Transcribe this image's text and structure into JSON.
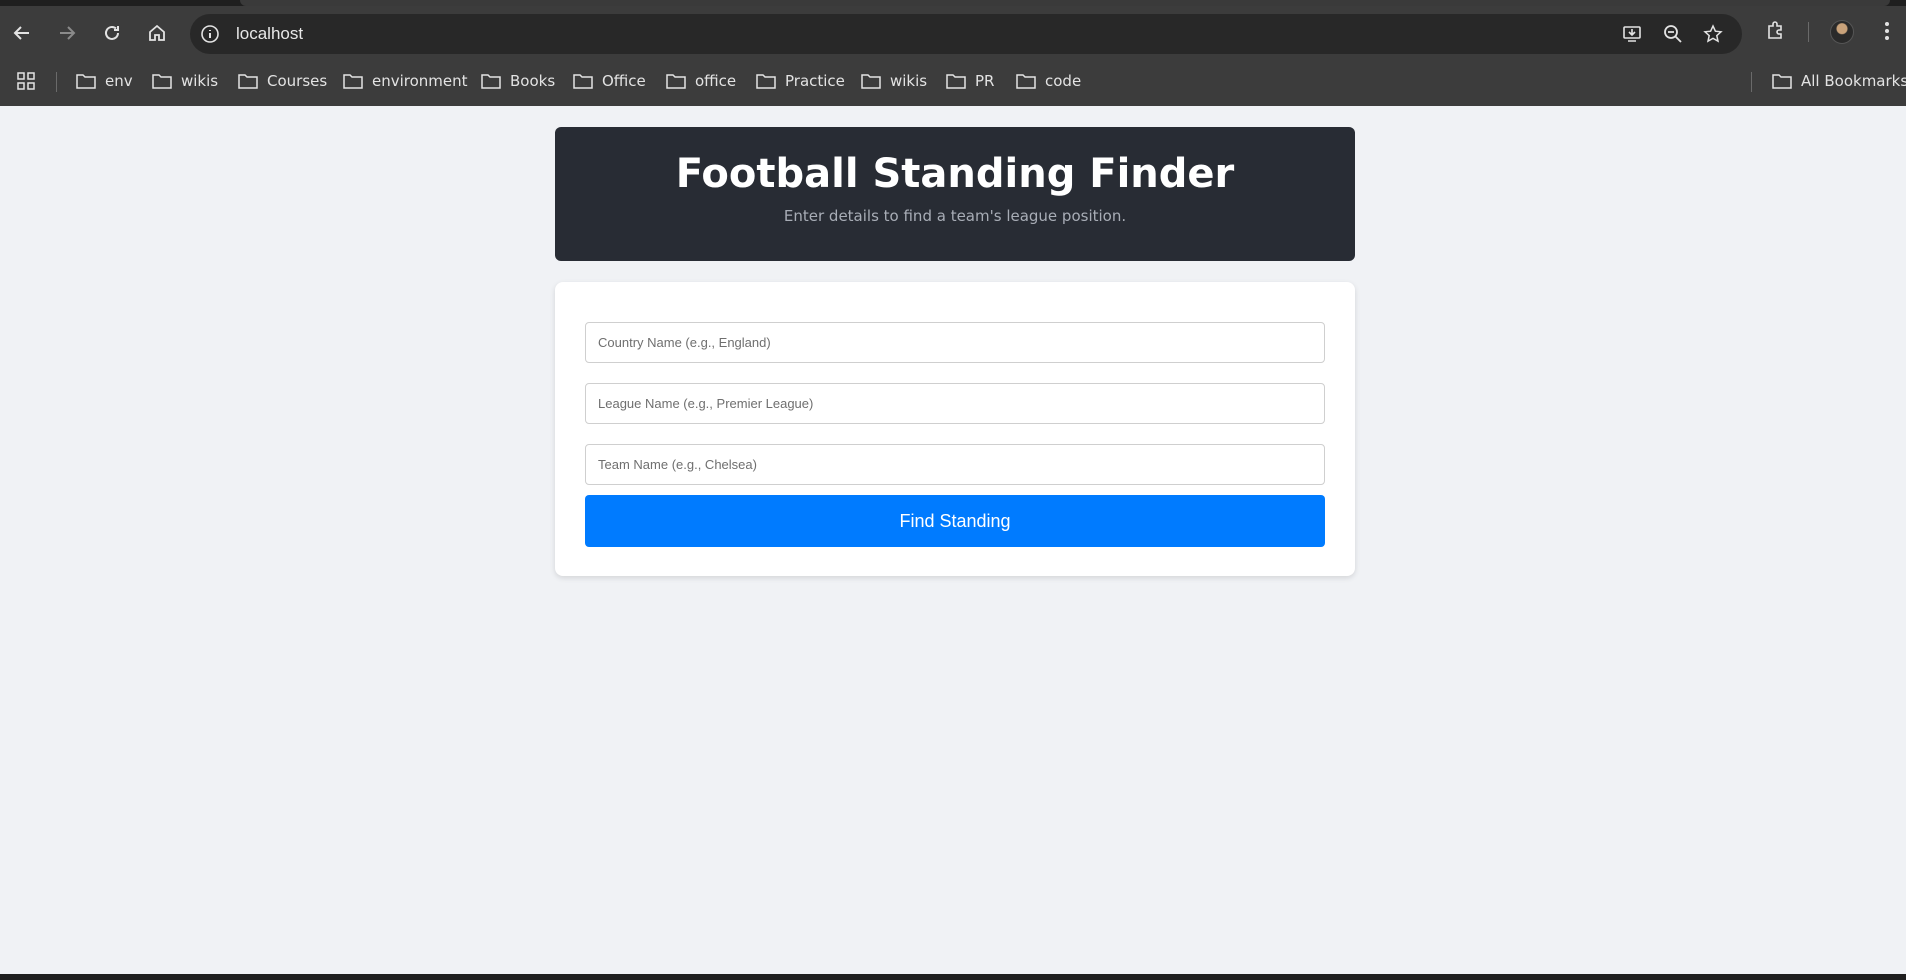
{
  "browser": {
    "url": "localhost",
    "bookmarks": [
      {
        "label": "env"
      },
      {
        "label": "wikis"
      },
      {
        "label": "Courses"
      },
      {
        "label": "environment"
      },
      {
        "label": "Books"
      },
      {
        "label": "Office"
      },
      {
        "label": "office"
      },
      {
        "label": "Practice"
      },
      {
        "label": "wikis"
      },
      {
        "label": "PR"
      },
      {
        "label": "code"
      }
    ],
    "all_bookmarks": "All Bookmarks"
  },
  "header": {
    "title": "Football Standing Finder",
    "subtitle": "Enter details to find a team's league position."
  },
  "form": {
    "country": {
      "placeholder": "Country Name (e.g., England)",
      "value": ""
    },
    "league": {
      "placeholder": "League Name (e.g., Premier League)",
      "value": ""
    },
    "team": {
      "placeholder": "Team Name (e.g., Chelsea)",
      "value": ""
    },
    "submit_label": "Find Standing"
  },
  "colors": {
    "header_bg": "#282c34",
    "button_bg": "#007bff",
    "page_bg": "#f0f2f5"
  }
}
